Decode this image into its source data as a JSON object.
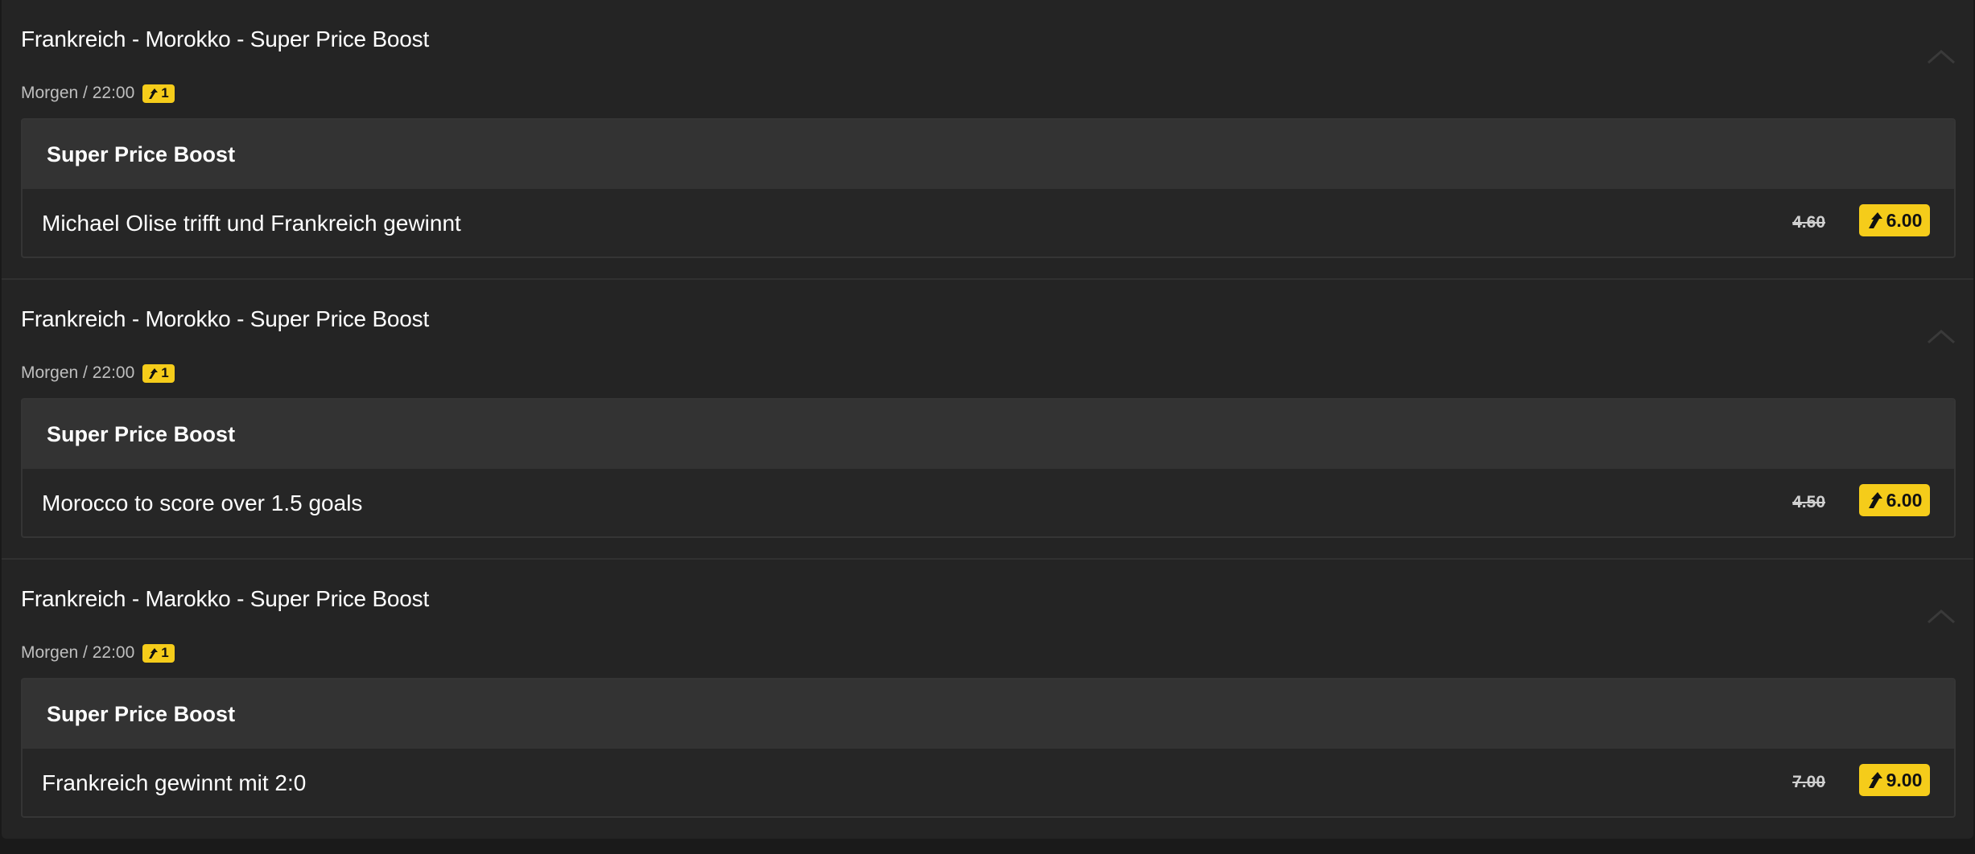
{
  "events": [
    {
      "title": "Frankreich - Morokko - Super Price Boost",
      "time": "Morgen / 22:00",
      "boost_count": "1",
      "market_title": "Super Price Boost",
      "selection": "Michael Olise trifft und Frankreich gewinnt",
      "old_price": "4.60",
      "boosted_price": "6.00"
    },
    {
      "title": "Frankreich - Morokko - Super Price Boost",
      "time": "Morgen / 22:00",
      "boost_count": "1",
      "market_title": "Super Price Boost",
      "selection": "Morocco to score over 1.5 goals",
      "old_price": "4.50",
      "boosted_price": "6.00"
    },
    {
      "title": "Frankreich - Marokko - Super Price Boost",
      "time": "Morgen / 22:00",
      "boost_count": "1",
      "market_title": "Super Price Boost",
      "selection": "Frankreich gewinnt mit 2:0",
      "old_price": "7.00",
      "boosted_price": "9.00"
    }
  ],
  "icons": {
    "boost": "boost-arrow-icon",
    "collapse": "chevron-up-icon"
  },
  "colors": {
    "accent": "#f5cc1a",
    "background": "#242424",
    "market_header": "#333333"
  }
}
